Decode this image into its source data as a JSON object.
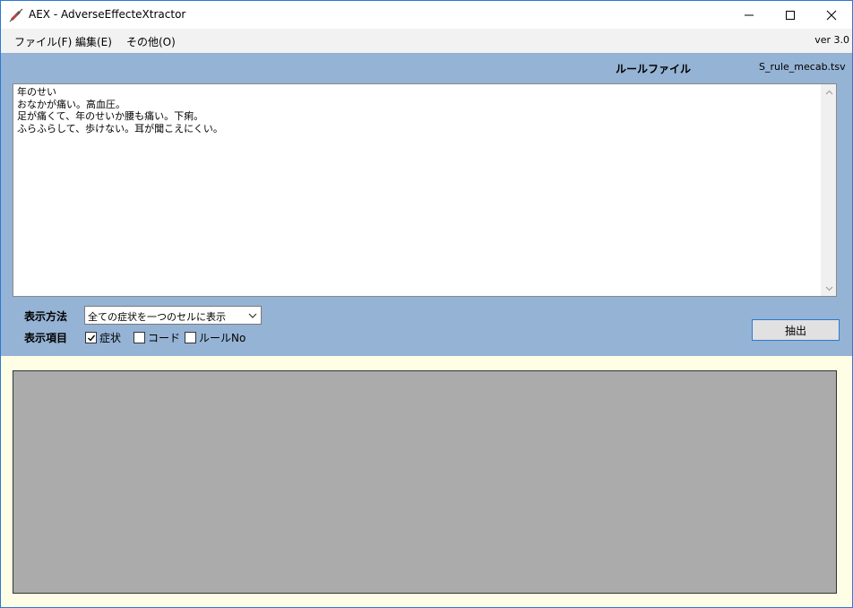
{
  "window": {
    "title": "AEX - AdverseEffecteXtractor",
    "controls": {
      "minimize_icon": "minimize-icon",
      "maximize_icon": "maximize-icon",
      "close_icon": "close-icon"
    }
  },
  "menu": {
    "items": [
      {
        "label": "ファイル(F)"
      },
      {
        "label": "編集(E)"
      },
      {
        "label": "その他(O)"
      }
    ],
    "version": "ver 3.0"
  },
  "rule": {
    "label": "ルールファイル",
    "file": "S_rule_mecab.tsv"
  },
  "input": {
    "text": "年のせい\nおなかが痛い。高血圧。\n足が痛くて、年のせいか腰も痛い。下痢。\nふらふらして、歩けない。耳が聞こえにくい。"
  },
  "display": {
    "method_label": "表示方法",
    "method_value": "全ての症状を一つのセルに表示",
    "items_label": "表示項目",
    "checkboxes": [
      {
        "label": "症状",
        "checked": true
      },
      {
        "label": "コード",
        "checked": false
      },
      {
        "label": "ルールNo",
        "checked": false
      }
    ]
  },
  "actions": {
    "extract_label": "抽出"
  },
  "colors": {
    "panel_blue": "#95b3d4",
    "panel_yellow": "#fefde6",
    "result_gray": "#ababab",
    "window_border": "#2b79d6"
  }
}
